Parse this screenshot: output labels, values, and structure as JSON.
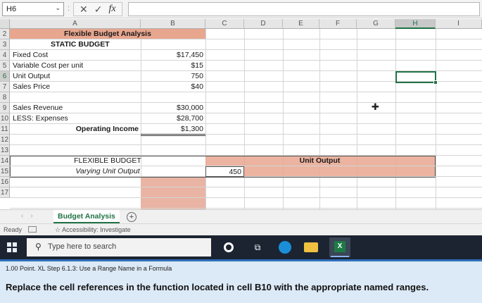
{
  "formula_bar": {
    "name_box": "H6",
    "separator": ":",
    "cancel_icon": "✕",
    "enter_icon": "✓",
    "fx_label": "fx",
    "formula": ""
  },
  "columns": [
    "A",
    "B",
    "C",
    "D",
    "E",
    "F",
    "G",
    "H",
    "I"
  ],
  "selected_column": "H",
  "rows": [
    "2",
    "3",
    "4",
    "5",
    "6",
    "7",
    "8",
    "9",
    "10",
    "11",
    "12",
    "13",
    "14",
    "15",
    "16",
    "17"
  ],
  "cells": {
    "A2": "Flexible Budget Analysis",
    "A3": "STATIC BUDGET",
    "A4": "Fixed Cost",
    "B4": "$17,450",
    "A5": "Variable Cost per unit",
    "B5": "$15",
    "A6": "Unit Output",
    "B6": "750",
    "A7": "Sales Price",
    "B7": "$40",
    "A9": "Sales Revenue",
    "B9": "$30,000",
    "A10": "LESS: Expenses",
    "B10": "$28,700",
    "A11": "Operating Income",
    "B11": "$1,300",
    "A13": "FLEXIBLE BUDGET",
    "A14": "Varying Unit Output",
    "E13": "Unit Output",
    "C14": "450"
  },
  "sheet_tabs": {
    "active": "Budget Analysis",
    "add_label": "+"
  },
  "status_bar": {
    "ready": "Ready",
    "accessibility": "Accessibility: Investigate"
  },
  "taskbar": {
    "search_placeholder": "Type here to search"
  },
  "instruction": {
    "step": "1.00 Point. XL Step 6.1.3: Use a Range Name in a Formula",
    "message": "Replace the cell references in the function located in cell B10 with the appropriate named ranges."
  },
  "colors": {
    "accent": "#217346",
    "header_fill": "#e8a68f",
    "input_fill": "#e9b4a4",
    "taskbar": "#1c2431",
    "instruction_bg": "#dce9f6"
  }
}
